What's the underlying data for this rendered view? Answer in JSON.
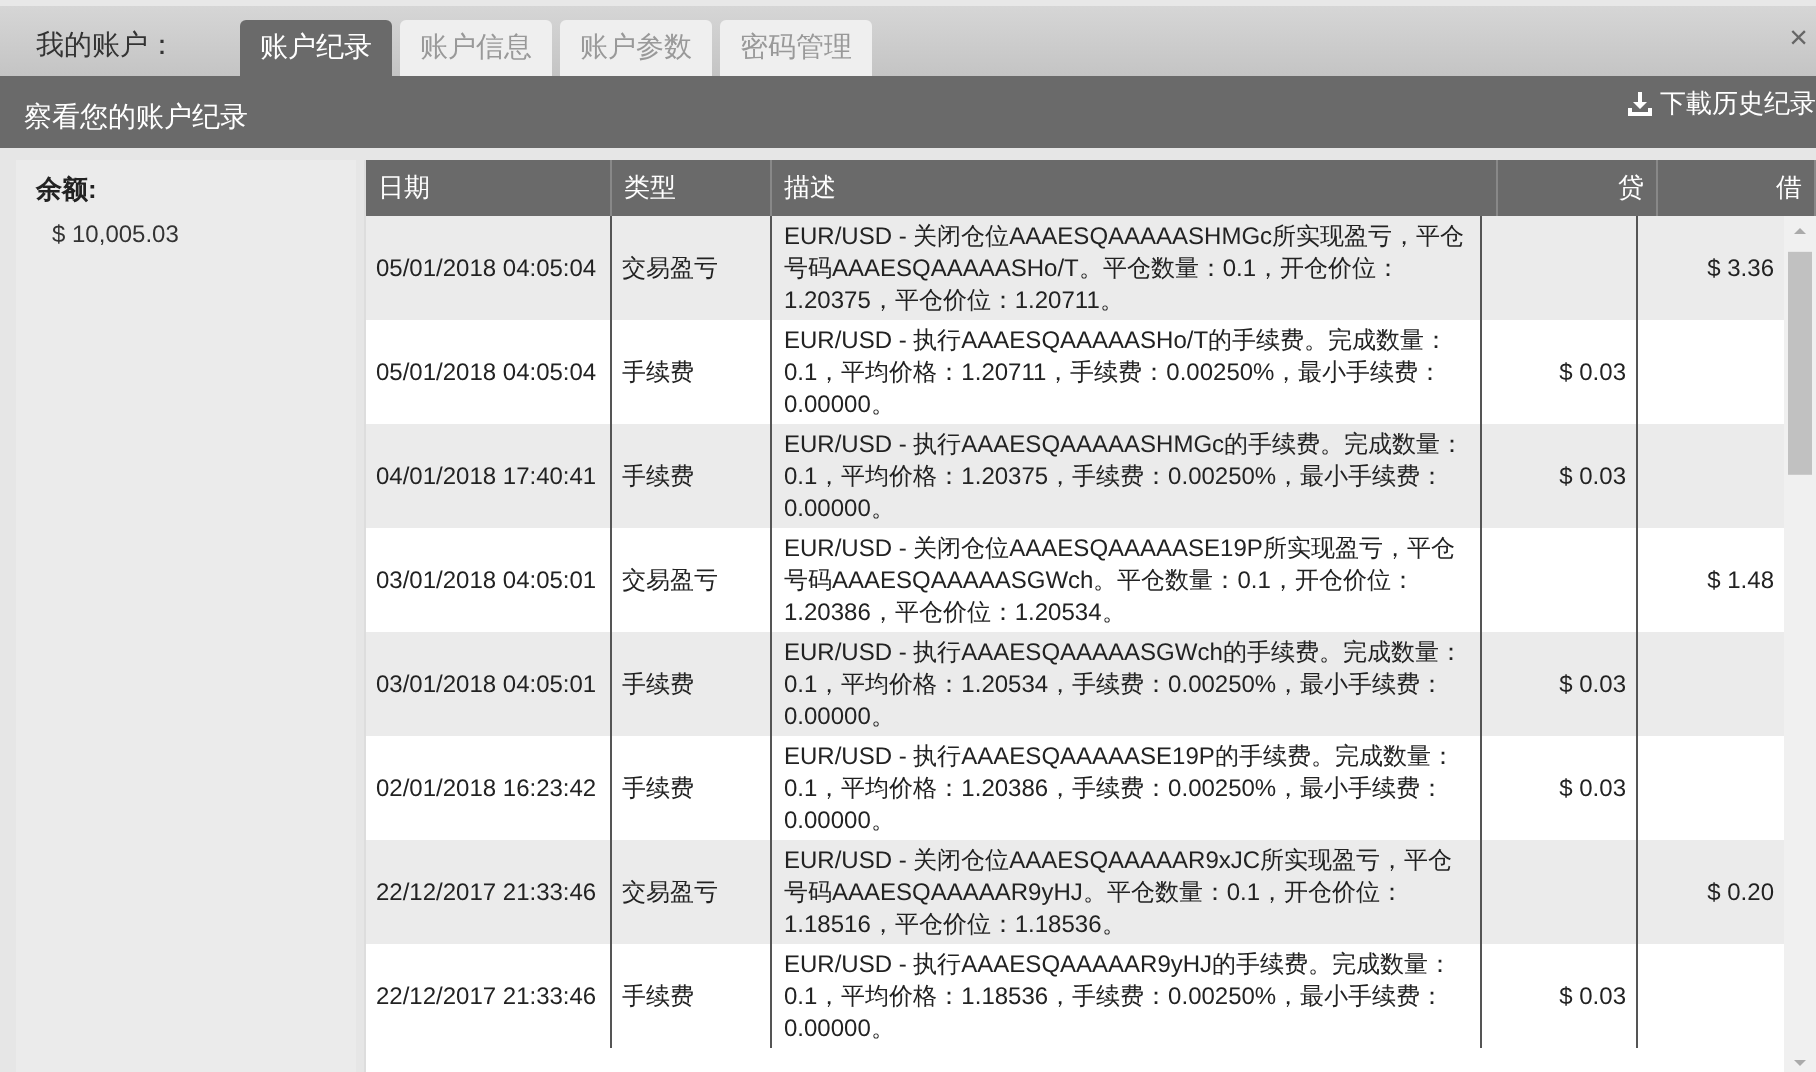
{
  "account_label": "我的账户：",
  "tabs": [
    {
      "label": "账户纪录",
      "selected": true
    },
    {
      "label": "账户信息",
      "selected": false
    },
    {
      "label": "账户参数",
      "selected": false
    },
    {
      "label": "密码管理",
      "selected": false
    }
  ],
  "close": "×",
  "header": {
    "title": "察看您的账户纪录",
    "download": "下載历史纪录"
  },
  "balance": {
    "label": "余额:",
    "value": "$ 10,005.03"
  },
  "table": {
    "columns": [
      "日期",
      "类型",
      "描述",
      "贷",
      "借"
    ],
    "rows": [
      {
        "date": "05/01/2018 04:05:04",
        "type": "交易盈亏",
        "description": "EUR/USD - 关闭仓位AAAESQAAAAASHMGc所实现盈亏，平仓号码AAAESQAAAAASHo/T。平仓数量：0.1，开仓价位：1.20375，平仓价位：1.20711。",
        "debit": "$ 3.36"
      },
      {
        "date": "05/01/2018 04:05:04",
        "type": "手续费",
        "description": "EUR/USD - 执行AAAESQAAAAASHo/T的手续费。完成数量：0.1，平均价格：1.20711，手续费：0.00250%，最小手续费：0.00000。",
        "credit": "$ 0.03"
      },
      {
        "date": "04/01/2018 17:40:41",
        "type": "手续费",
        "description": "EUR/USD - 执行AAAESQAAAAASHMGc的手续费。完成数量：0.1，平均价格：1.20375，手续费：0.00250%，最小手续费：0.00000。",
        "credit": "$ 0.03"
      },
      {
        "date": "03/01/2018 04:05:01",
        "type": "交易盈亏",
        "description": "EUR/USD - 关闭仓位AAAESQAAAAASE19P所实现盈亏，平仓号码AAAESQAAAAASGWch。平仓数量：0.1，开仓价位：1.20386，平仓价位：1.20534。",
        "debit": "$ 1.48"
      },
      {
        "date": "03/01/2018 04:05:01",
        "type": "手续费",
        "description": "EUR/USD - 执行AAAESQAAAAASGWch的手续费。完成数量：0.1，平均价格：1.20534，手续费：0.00250%，最小手续费：0.00000。",
        "credit": "$ 0.03"
      },
      {
        "date": "02/01/2018 16:23:42",
        "type": "手续费",
        "description": "EUR/USD - 执行AAAESQAAAAASE19P的手续费。完成数量：0.1，平均价格：1.20386，手续费：0.00250%，最小手续费：0.00000。",
        "credit": "$ 0.03"
      },
      {
        "date": "22/12/2017 21:33:46",
        "type": "交易盈亏",
        "description": "EUR/USD - 关闭仓位AAAESQAAAAAR9xJC所实现盈亏，平仓号码AAAESQAAAAAR9yHJ。平仓数量：0.1，开仓价位：1.18516，平仓价位：1.18536。",
        "debit": "$ 0.20"
      },
      {
        "date": "22/12/2017 21:33:46",
        "type": "手续费",
        "description": "EUR/USD - 执行AAAESQAAAAAR9yHJ的手续费。完成数量：0.1，平均价格：1.18536，手续费：0.00250%，最小手续费：0.00000。",
        "credit": "$ 0.03"
      }
    ]
  }
}
